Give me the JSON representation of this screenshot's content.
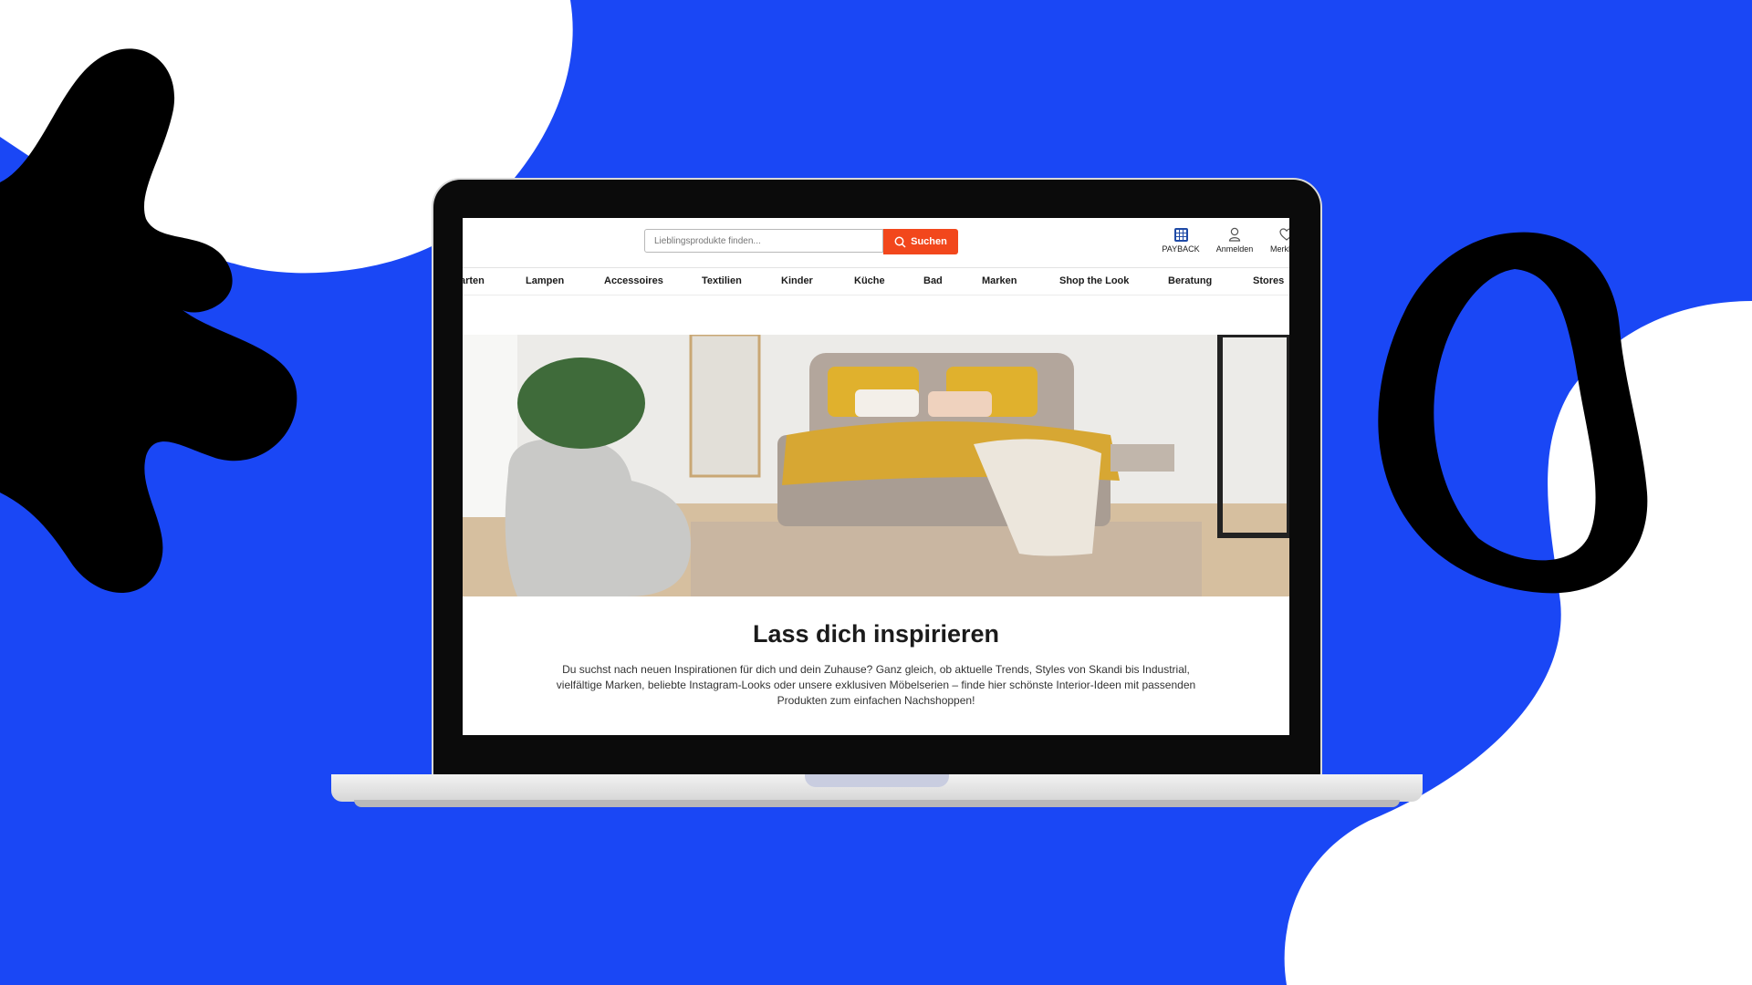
{
  "search": {
    "placeholder": "Lieblingsprodukte finden...",
    "button_label": "Suchen"
  },
  "header": {
    "payback_label": "PAYBACK",
    "login_label": "Anmelden",
    "wishlist_label": "Merkliste"
  },
  "nav": {
    "items": [
      "arten",
      "Lampen",
      "Accessoires",
      "Textilien",
      "Kinder",
      "Küche",
      "Bad",
      "Marken",
      "Shop the Look",
      "Beratung",
      "Stores"
    ]
  },
  "content": {
    "title": "Lass dich inspirieren",
    "description": "Du suchst nach neuen Inspirationen für dich und dein Zuhause? Ganz gleich, ob aktuelle Trends, Styles von Skandi bis Industrial, vielfältige Marken, beliebte Instagram-Looks oder unsere exklusiven Möbelserien – finde hier schönste Interior-Ideen mit passenden Produkten zum einfachen Nachshoppen!"
  },
  "colors": {
    "background": "#1a47f5",
    "accent": "#f2471c",
    "payback": "#1f4aa6"
  }
}
